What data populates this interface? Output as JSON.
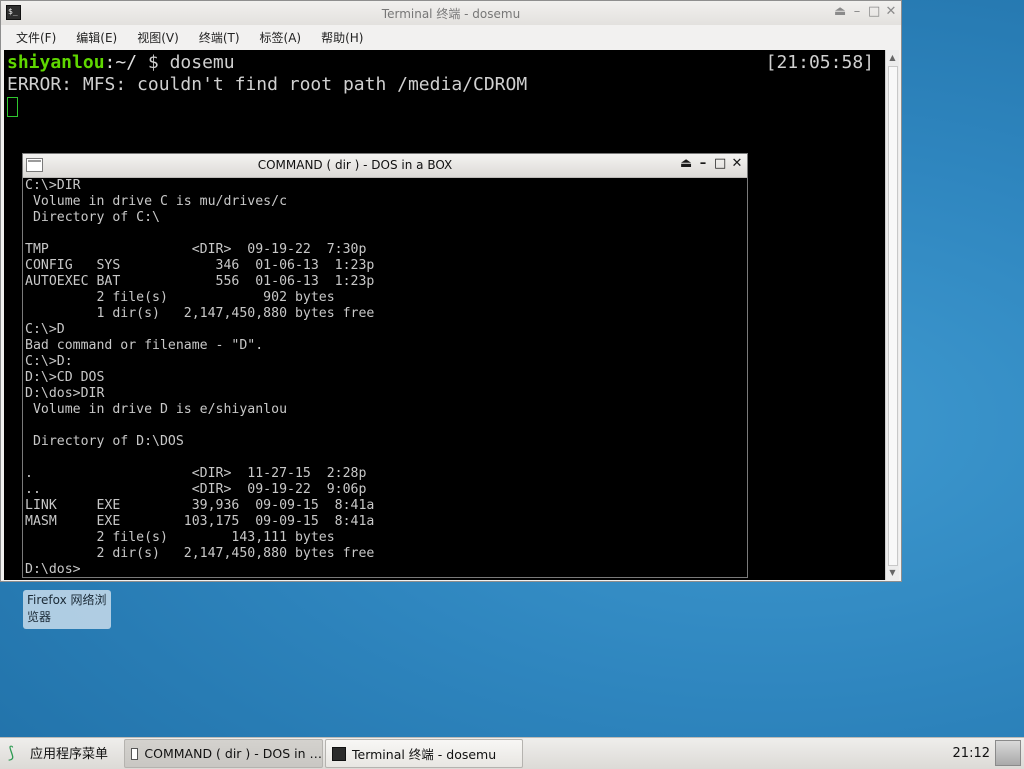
{
  "terminal": {
    "title": "Terminal 终端 - dosemu",
    "menu": [
      "文件(F)",
      "编辑(E)",
      "视图(V)",
      "终端(T)",
      "标签(A)",
      "帮助(H)"
    ],
    "prompt_user": "shiyanlou",
    "prompt_path": ":~/",
    "prompt_command": " $ dosemu",
    "clock": "[21:05:58]",
    "error_line": "ERROR: MFS: couldn't find root path /media/CDROM"
  },
  "dosbox": {
    "title": "COMMAND ( dir ) - DOS in a BOX",
    "screen_lines": [
      "C:\\>DIR",
      " Volume in drive C is mu/drives/c",
      " Directory of C:\\",
      "",
      "TMP                  <DIR>  09-19-22  7:30p",
      "CONFIG   SYS            346  01-06-13  1:23p",
      "AUTOEXEC BAT            556  01-06-13  1:23p",
      "         2 file(s)            902 bytes",
      "         1 dir(s)   2,147,450,880 bytes free",
      "C:\\>D",
      "Bad command or filename - \"D\".",
      "C:\\>D:",
      "D:\\>CD DOS",
      "D:\\dos>DIR",
      " Volume in drive D is e/shiyanlou",
      "",
      " Directory of D:\\DOS",
      "",
      ".                    <DIR>  11-27-15  2:28p",
      "..                   <DIR>  09-19-22  9:06p",
      "LINK     EXE         39,936  09-09-15  8:41a",
      "MASM     EXE        103,175  09-09-15  8:41a",
      "         2 file(s)        143,111 bytes",
      "         2 dir(s)   2,147,450,880 bytes free",
      "D:\\dos>"
    ]
  },
  "desktop": {
    "icon_label": "Firefox 网络浏览器"
  },
  "taskbar": {
    "start_label": "应用程序菜单",
    "tasks": [
      {
        "label": "COMMAND ( dir ) - DOS in …",
        "icon": "dos-window-icon"
      },
      {
        "label": "Terminal 终端 - dosemu",
        "icon": "terminal-icon"
      }
    ],
    "clock": "21:12"
  },
  "icons": {
    "window_controls": [
      "shade-icon",
      "minimize-icon",
      "maximize-icon",
      "close-icon"
    ]
  }
}
